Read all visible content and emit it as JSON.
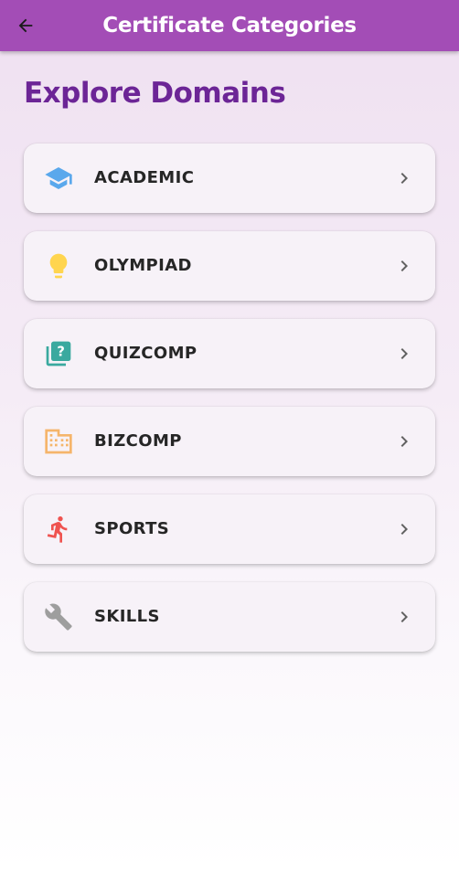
{
  "header": {
    "title": "Certificate Categories",
    "back_icon": "arrow-left-icon",
    "background": "#a34db6"
  },
  "page": {
    "heading": "Explore Domains",
    "heading_color": "#6c2596"
  },
  "categories": [
    {
      "label": "ACADEMIC",
      "icon": "graduation-cap-icon",
      "icon_color": "#5aa8ec"
    },
    {
      "label": "OLYMPIAD",
      "icon": "lightbulb-icon",
      "icon_color": "#ffd54f"
    },
    {
      "label": "QUIZCOMP",
      "icon": "quiz-icon",
      "icon_color": "#3aa99f"
    },
    {
      "label": "BIZCOMP",
      "icon": "corporate-building-icon",
      "icon_color": "#f5b56b"
    },
    {
      "label": "SPORTS",
      "icon": "running-person-icon",
      "icon_color": "#ef5350"
    },
    {
      "label": "SKILLS",
      "icon": "wrench-icon",
      "icon_color": "#9e9e9e"
    }
  ]
}
